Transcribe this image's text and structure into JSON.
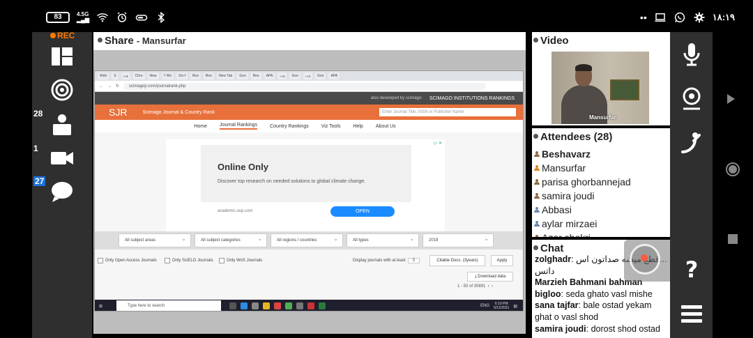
{
  "status": {
    "battery": "83",
    "network": "4.5G",
    "time": "١٨:١٩"
  },
  "rail": {
    "rec_label": "REC",
    "attendee_count": "28",
    "video_count": "1",
    "chat_count": "27"
  },
  "share": {
    "title": "Share",
    "presenter": "- Mansurfar"
  },
  "browser": {
    "tabs": [
      "Web",
      "S",
      "وب",
      "Chro",
      "New",
      "7 Wo",
      "Sci-f",
      "Boo",
      "Boo",
      "New Tab",
      "Goo",
      "Boo",
      "APA",
      "وب",
      "Goo",
      "وب",
      "Goo",
      "APA"
    ],
    "url": "scimagojr.com/journalrank.php",
    "dark_bar_text": "also developed by scimago:",
    "institutions": "SCIMAGO INSTITUTIONS RANKINGS",
    "logo": "SJR",
    "site_name": "Scimago Journal & Country Rank",
    "search_placeholder": "Enter Journal Title, ISSN or Publisher Name",
    "nav": [
      "Home",
      "Journal Rankings",
      "Country Rankings",
      "Viz Tools",
      "Help",
      "About Us"
    ],
    "ad": {
      "title": "Online Only",
      "desc": "Discover top research on needed solutions to global climate change.",
      "domain": "academic.oup.com",
      "button": "OPEN"
    },
    "filters": [
      "All subject areas",
      "All subject categories",
      "All regions / countries",
      "All types",
      "2019"
    ],
    "checks": [
      "Only Open Access Journals",
      "Only SciELO Journals",
      "Only WoS Journals"
    ],
    "display_label": "Display journals with at least",
    "display_value": "0",
    "citable": "Citable Docs. (3years)",
    "apply": "Apply",
    "download": "Download data",
    "pager": "1 - 50 of 30891",
    "taskbar_search": "Type here to search",
    "taskbar_time": "6:19 PM",
    "taskbar_date": "5/12/2021",
    "taskbar_lang": "ENG"
  },
  "video": {
    "title": "Video",
    "presenter_label": "Mansurfar"
  },
  "attendees": {
    "title": "Attendees (28)",
    "list": [
      {
        "name": "Beshavarz",
        "bold": true,
        "color": "#8a6a40"
      },
      {
        "name": "Mansurfar",
        "bold": false,
        "color": "#d4861e"
      },
      {
        "name": "parisa ghorbannejad",
        "bold": false,
        "color": "#8a6a40"
      },
      {
        "name": "samira joudi",
        "bold": false,
        "color": "#8a6a40"
      },
      {
        "name": "Abbasi",
        "bold": false,
        "color": "#6a86b0"
      },
      {
        "name": "aylar mirzaei",
        "bold": false,
        "color": "#6a86b0"
      },
      {
        "name": "Azar shokri",
        "bold": false,
        "color": "#8a6a40"
      }
    ]
  },
  "chat": {
    "title": "Chat",
    "messages": [
      {
        "author": "zolghadr",
        "text": "قطع میشه صداتون اس...",
        "extra": "داتس"
      },
      {
        "author": "Marzieh Bahmani bahman bigloo",
        "text": "seda ghato vasl mishe"
      },
      {
        "author": "sana tajfar",
        "text": "bale ostad yekam ghat o vasl shod"
      },
      {
        "author": "samira joudi",
        "text": "dorost shod ostad"
      }
    ]
  }
}
